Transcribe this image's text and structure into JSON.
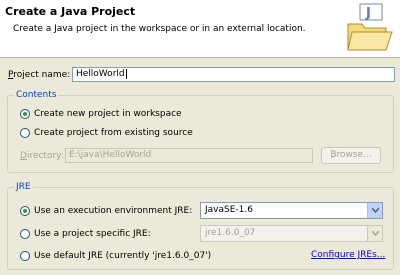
{
  "header": {
    "title": "Create a Java Project",
    "description": "Create a Java project in the workspace or in an external location.",
    "icon": "new-java-project-folder-icon"
  },
  "project_name": {
    "label_mnemonic": "P",
    "label_rest": "roject name:",
    "value": "HelloWorld"
  },
  "contents": {
    "title": "Contents",
    "options": [
      {
        "label": "Create new project in workspace",
        "checked": true
      },
      {
        "label": "Create project from existing source",
        "checked": false
      }
    ],
    "directory": {
      "label_mnemonic": "D",
      "label_rest": "irectory:",
      "value": "E:\\java\\HelloWorld",
      "browse_label": "Browse..."
    }
  },
  "jre": {
    "title": "JRE",
    "options": [
      {
        "label": "Use an execution environment JRE:",
        "checked": true,
        "combo_value": "JavaSE-1.6"
      },
      {
        "label": "Use a project specific JRE:",
        "checked": false,
        "combo_value": "jre1.6.0_07"
      },
      {
        "label": "Use default JRE (currently 'jre1.6.0_07')",
        "checked": false
      }
    ],
    "configure_link": "Configure JREs..."
  },
  "colors": {
    "accent": "#0046d5",
    "radio_dot": "#21a121",
    "link": "#0000ee"
  }
}
